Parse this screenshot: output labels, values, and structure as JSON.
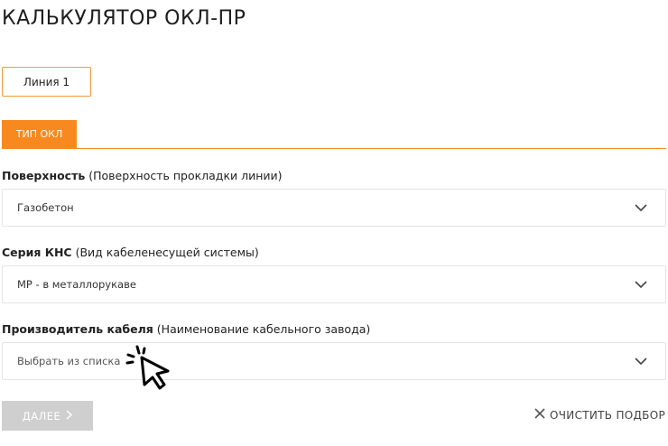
{
  "page": {
    "title": "КАЛЬКУЛЯТОР ОКЛ-ПР"
  },
  "line_tab": {
    "label": "Линия 1"
  },
  "type_tab": {
    "label": "ТИП ОКЛ"
  },
  "fields": [
    {
      "label_bold": "Поверхность",
      "label_note": "(Поверхность прокладки линии)",
      "value": "Газобетон"
    },
    {
      "label_bold": "Серия КНС",
      "label_note": "(Вид кабеленесущей системы)",
      "value": "МР - в металлорукаве"
    },
    {
      "label_bold": "Производитель кабеля",
      "label_note": "(Наименование кабельного завода)",
      "value": "Выбрать из списка"
    }
  ],
  "actions": {
    "next_label": "ДАЛЕЕ",
    "clear_label": "ОЧИСТИТЬ ПОДБОР"
  },
  "colors": {
    "accent": "#f7891f",
    "disabled": "#cfcfcf"
  },
  "icons": {
    "select_arrow": "chevron-down-icon",
    "next_arrow": "chevron-right-icon",
    "clear": "close-icon",
    "cursor": "click-cursor-icon"
  }
}
